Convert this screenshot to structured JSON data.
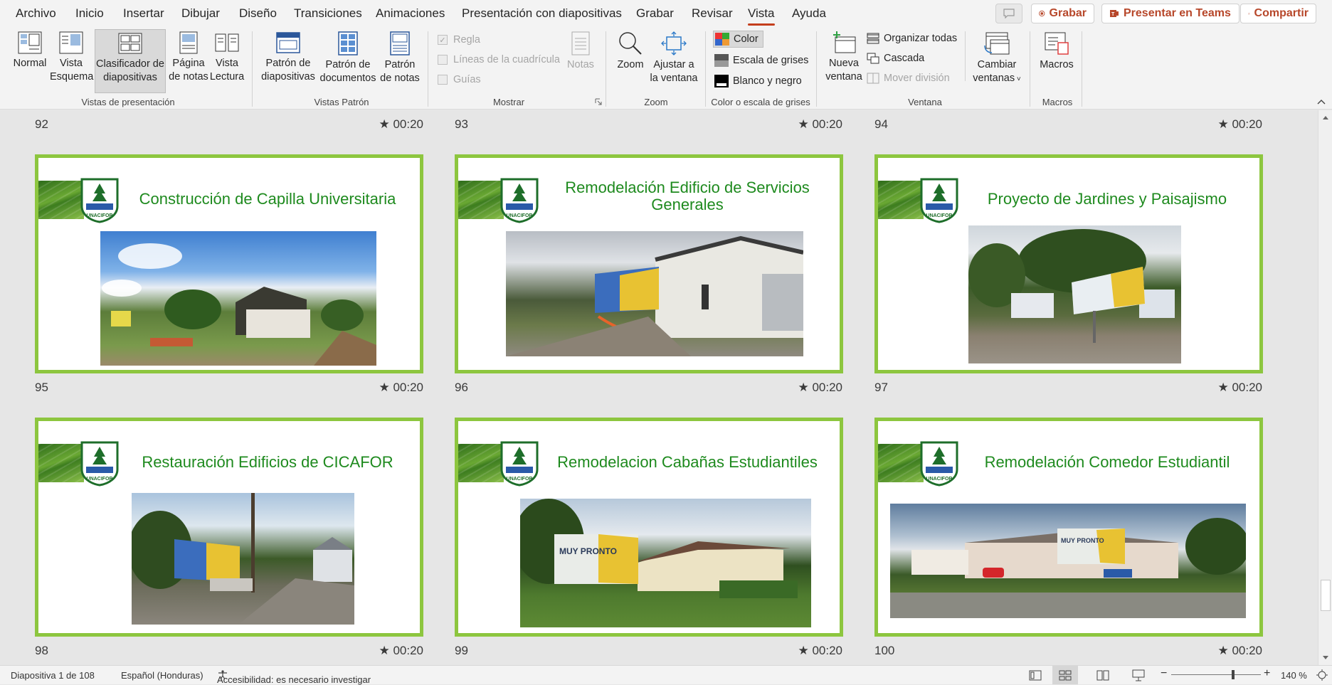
{
  "tabs": [
    "Archivo",
    "Inicio",
    "Insertar",
    "Dibujar",
    "Diseño",
    "Transiciones",
    "Animaciones",
    "Presentación con diapositivas",
    "Grabar",
    "Revisar",
    "Vista",
    "Ayuda"
  ],
  "active_tab": "Vista",
  "top_actions": {
    "record": "Grabar",
    "teams": "Presentar en Teams",
    "share": "Compartir"
  },
  "ribbon": {
    "views": {
      "normal": "Normal",
      "outline": [
        "Vista",
        "Esquema"
      ],
      "sorter": [
        "Clasificador de",
        "diapositivas"
      ],
      "notes_page": [
        "Página",
        "de notas"
      ],
      "reading": [
        "Vista",
        "Lectura"
      ],
      "label": "Vistas de presentación"
    },
    "masters": {
      "slide": [
        "Patrón de",
        "diapositivas"
      ],
      "handout": [
        "Patrón de",
        "documentos"
      ],
      "notes": [
        "Patrón",
        "de notas"
      ],
      "label": "Vistas Patrón"
    },
    "show": {
      "ruler": "Regla",
      "gridlines": "Líneas de la cuadrícula",
      "guides": "Guías",
      "notes": "Notas",
      "label": "Mostrar"
    },
    "zoom": {
      "zoom": "Zoom",
      "fit": [
        "Ajustar a",
        "la ventana"
      ],
      "label": "Zoom"
    },
    "color": {
      "color": "Color",
      "grayscale": "Escala de grises",
      "bw": "Blanco y negro",
      "label": "Color o escala de grises"
    },
    "window": {
      "new": [
        "Nueva",
        "ventana"
      ],
      "arrange": "Organizar todas",
      "cascade": "Cascada",
      "split": "Mover división",
      "switch": [
        "Cambiar",
        "ventanas"
      ],
      "label": "Ventana"
    },
    "macros": {
      "macros": "Macros",
      "label": "Macros"
    }
  },
  "top_row": [
    {
      "num": "92",
      "dur": "00:20"
    },
    {
      "num": "93",
      "dur": "00:20"
    },
    {
      "num": "94",
      "dur": "00:20"
    }
  ],
  "slides": [
    {
      "num": "95",
      "dur": "00:20",
      "title": "Construcción de Capilla Universitaria"
    },
    {
      "num": "96",
      "dur": "00:20",
      "title": "Remodelación Edificio de Servicios Generales"
    },
    {
      "num": "97",
      "dur": "00:20",
      "title": "Proyecto de Jardines y Paisajismo"
    },
    {
      "num": "98",
      "dur": "00:20",
      "title": "Restauración Edificios de CICAFOR"
    },
    {
      "num": "99",
      "dur": "00:20",
      "title": "Remodelacion Cabañas Estudiantiles"
    },
    {
      "num": "100",
      "dur": "00:20",
      "title": "Remodelación Comedor Estudiantil"
    }
  ],
  "photo_sign_text": "MUY PRONTO",
  "logo_text": "UNACIFOR",
  "status": {
    "slide": "Diapositiva 1 de 108",
    "lang": "Español (Honduras)",
    "a11y": "Accesibilidad: es necesario investigar",
    "zoom": "140 %"
  },
  "colors": {
    "accent": "#c43e1c",
    "slide_border": "#8dc63f",
    "title_green": "#1e8a1e"
  }
}
